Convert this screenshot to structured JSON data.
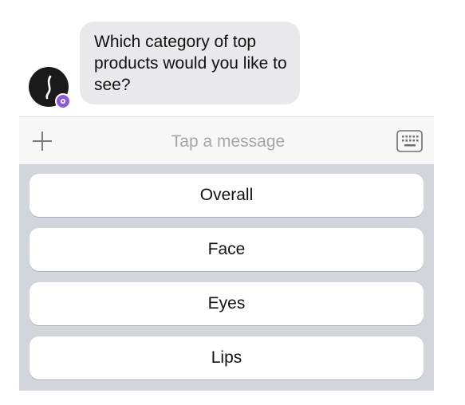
{
  "chat": {
    "bot_message": "Which category of top products would you like to see?"
  },
  "composer": {
    "placeholder": "Tap a message",
    "plus_icon": "plus-icon",
    "keyboard_icon": "keyboard-icon"
  },
  "quick_replies": [
    {
      "label": "Overall"
    },
    {
      "label": "Face"
    },
    {
      "label": "Eyes"
    },
    {
      "label": "Lips"
    }
  ],
  "colors": {
    "bubble": "#e9e9eb",
    "panel": "#d2d5db",
    "badge": "#8e5bd6",
    "avatar": "#1a1a1a"
  }
}
